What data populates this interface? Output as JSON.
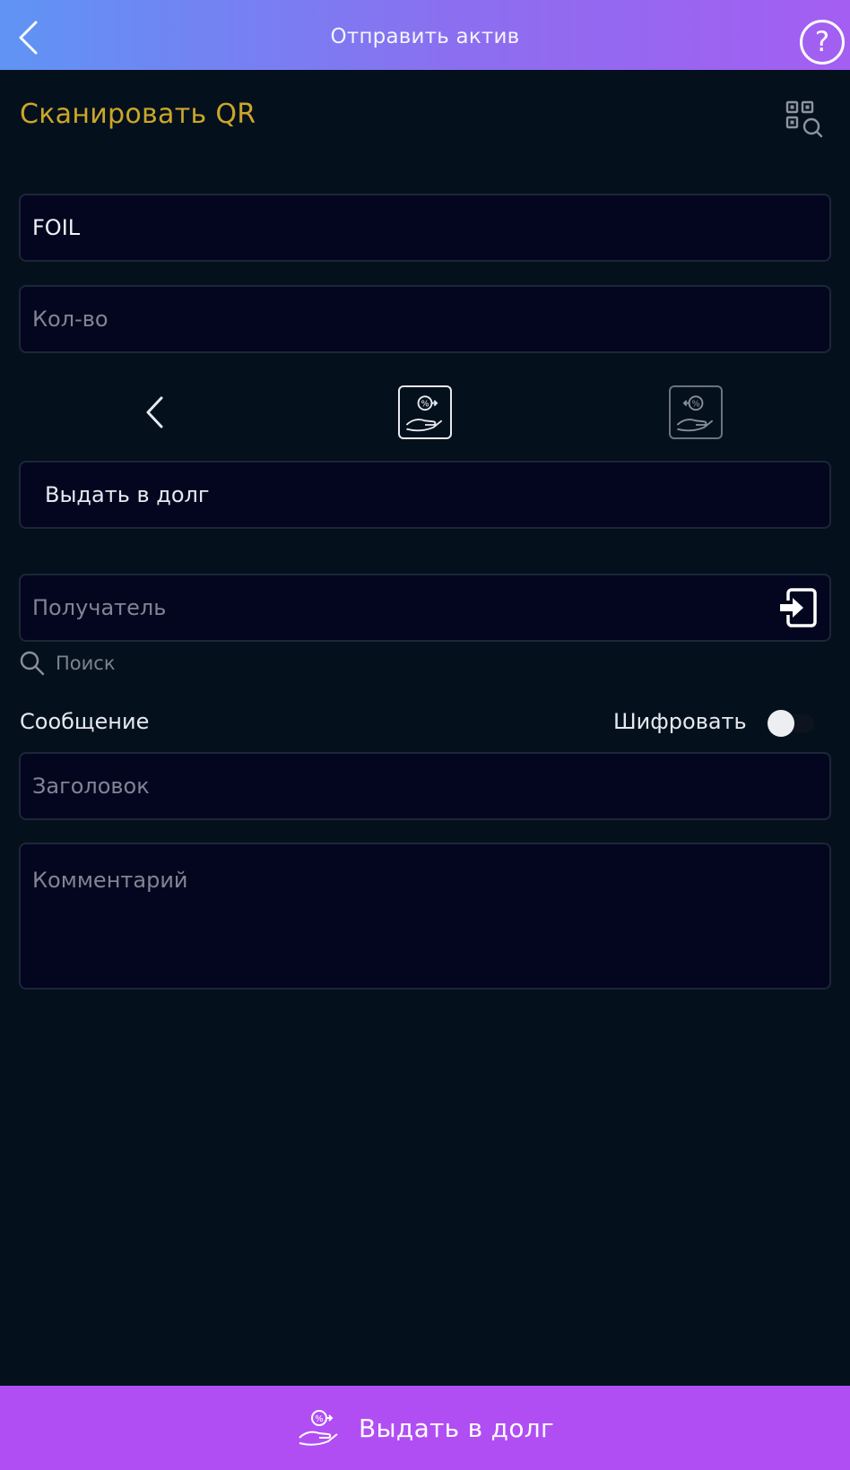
{
  "header": {
    "title": "Отправить актив"
  },
  "scan": {
    "label": "Сканировать QR"
  },
  "form": {
    "asset_value": "FOIL",
    "amount_placeholder": "Кол-во",
    "mode_label": "Выдать в долг",
    "recipient_placeholder": "Получатель",
    "search_label": "Поиск",
    "message_label": "Сообщение",
    "encrypt_label": "Шифровать",
    "subject_placeholder": "Заголовок",
    "comment_placeholder": "Комментарий"
  },
  "footer": {
    "button_label": "Выдать в долг"
  },
  "colors": {
    "header_gradient_start": "#5f94f4",
    "header_gradient_end": "#a45ef2",
    "accent_gold": "#cda629",
    "footer_button": "#b04ef4",
    "background": "#04111d",
    "field_background": "#04061f"
  },
  "icons": {
    "back": "chevron-left-icon",
    "help": "question-circle-icon",
    "qr_scan": "qr-search-icon",
    "mode_prev": "chevron-left-icon",
    "lend": "hand-coin-out-icon",
    "borrow": "hand-coin-in-icon",
    "recipient_picker": "import-file-icon",
    "search": "magnifier-icon"
  }
}
